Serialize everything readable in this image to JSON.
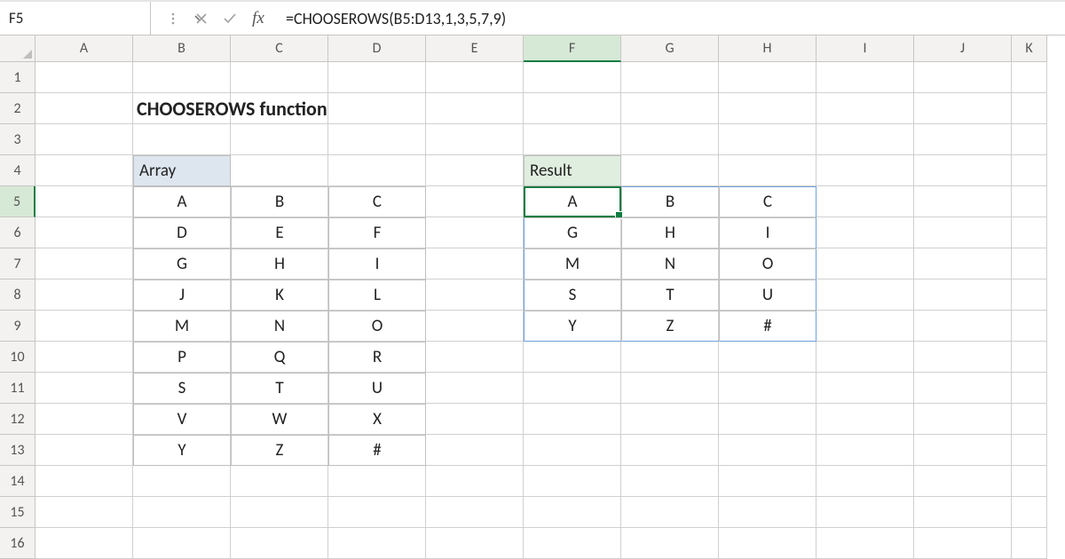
{
  "formula_bar": {
    "name_box": "F5",
    "formula": "=CHOOSEROWS(B5:D13,1,3,5,7,9)"
  },
  "columns": [
    "A",
    "B",
    "C",
    "D",
    "E",
    "F",
    "G",
    "H",
    "I",
    "J",
    "K"
  ],
  "rows": [
    "1",
    "2",
    "3",
    "4",
    "5",
    "6",
    "7",
    "8",
    "9",
    "10",
    "11",
    "12",
    "13",
    "14",
    "15",
    "16"
  ],
  "selected_column_index": 5,
  "selected_row_index": 4,
  "title": "CHOOSEROWS function",
  "labels": {
    "array": "Array",
    "result": "Result"
  },
  "array_data": [
    [
      "A",
      "B",
      "C"
    ],
    [
      "D",
      "E",
      "F"
    ],
    [
      "G",
      "H",
      "I"
    ],
    [
      "J",
      "K",
      "L"
    ],
    [
      "M",
      "N",
      "O"
    ],
    [
      "P",
      "Q",
      "R"
    ],
    [
      "S",
      "T",
      "U"
    ],
    [
      "V",
      "W",
      "X"
    ],
    [
      "Y",
      "Z",
      "#"
    ]
  ],
  "result_data": [
    [
      "A",
      "B",
      "C"
    ],
    [
      "G",
      "H",
      "I"
    ],
    [
      "M",
      "N",
      "O"
    ],
    [
      "S",
      "T",
      "U"
    ],
    [
      "Y",
      "Z",
      "#"
    ]
  ]
}
